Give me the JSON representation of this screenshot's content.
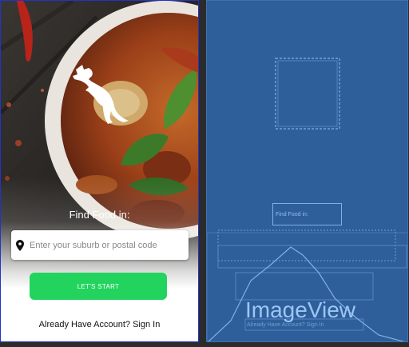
{
  "phone": {
    "find_label": "Find Food in:",
    "search": {
      "placeholder": "Enter your suburb or postal code",
      "value": ""
    },
    "start_button": "LET'S START",
    "signin_text": "Already Have Account? Sign In",
    "accent_color": "#22d45e"
  },
  "blueprint": {
    "find_label": "Find Food in:",
    "image_view_label": "ImageView",
    "signin_text": "Already Have Account? Sign In"
  }
}
